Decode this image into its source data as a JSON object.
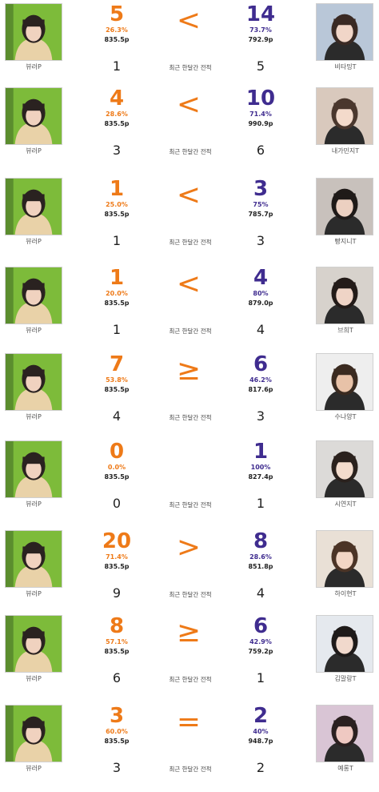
{
  "period_label": "최근 한달간 전적",
  "rows": [
    {
      "left_name": "뷰러P",
      "left_score": "5",
      "left_pct": "26.3%",
      "left_points": "835.5p",
      "comparator": "<",
      "right_score": "14",
      "right_pct": "73.7%",
      "right_points": "792.9p",
      "right_name": "비타밍T",
      "left_count": "1",
      "right_count": "5"
    },
    {
      "left_name": "뷰러P",
      "left_score": "4",
      "left_pct": "28.6%",
      "left_points": "835.5p",
      "comparator": "<",
      "right_score": "10",
      "right_pct": "71.4%",
      "right_points": "990.9p",
      "right_name": "내가민지T",
      "left_count": "3",
      "right_count": "6"
    },
    {
      "left_name": "뷰러P",
      "left_score": "1",
      "left_pct": "25.0%",
      "left_points": "835.5p",
      "comparator": "<",
      "right_score": "3",
      "right_pct": "75%",
      "right_points": "785.7p",
      "right_name": "빵지니T",
      "left_count": "1",
      "right_count": "3"
    },
    {
      "left_name": "뷰러P",
      "left_score": "1",
      "left_pct": "20.0%",
      "left_points": "835.5p",
      "comparator": "<",
      "right_score": "4",
      "right_pct": "80%",
      "right_points": "879.0p",
      "right_name": "브희T",
      "left_count": "1",
      "right_count": "4"
    },
    {
      "left_name": "뷰러P",
      "left_score": "7",
      "left_pct": "53.8%",
      "left_points": "835.5p",
      "comparator": "≥",
      "right_score": "6",
      "right_pct": "46.2%",
      "right_points": "817.6p",
      "right_name": "수나양T",
      "left_count": "4",
      "right_count": "3"
    },
    {
      "left_name": "뷰러P",
      "left_score": "0",
      "left_pct": "0.0%",
      "left_points": "835.5p",
      "comparator": "",
      "right_score": "1",
      "right_pct": "100%",
      "right_points": "827.4p",
      "right_name": "시연지T",
      "left_count": "0",
      "right_count": "1"
    },
    {
      "left_name": "뷰러P",
      "left_score": "20",
      "left_pct": "71.4%",
      "left_points": "835.5p",
      "comparator": ">",
      "right_score": "8",
      "right_pct": "28.6%",
      "right_points": "851.8p",
      "right_name": "하이현T",
      "left_count": "9",
      "right_count": "4"
    },
    {
      "left_name": "뷰러P",
      "left_score": "8",
      "left_pct": "57.1%",
      "left_points": "835.5p",
      "comparator": "≥",
      "right_score": "6",
      "right_pct": "42.9%",
      "right_points": "759.2p",
      "right_name": "김말랑T",
      "left_count": "6",
      "right_count": "1"
    },
    {
      "left_name": "뷰러P",
      "left_score": "3",
      "left_pct": "60.0%",
      "left_points": "835.5p",
      "comparator": "=",
      "right_score": "2",
      "right_pct": "40%",
      "right_points": "948.7p",
      "right_name": "예롱T",
      "left_count": "3",
      "right_count": "2"
    }
  ],
  "colors": {
    "left_accent": "#ee7a18",
    "right_accent": "#3f2c8f"
  }
}
